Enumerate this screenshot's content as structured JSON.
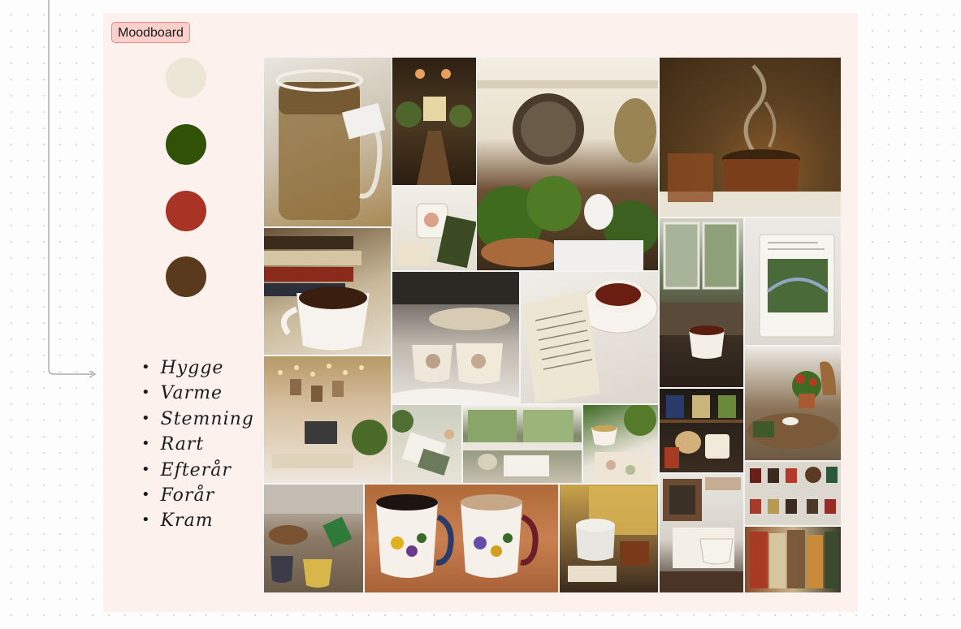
{
  "frame": {
    "label": "Moodboard"
  },
  "palette": [
    {
      "name": "cream",
      "color": "#ebe6d5"
    },
    {
      "name": "forest-green",
      "color": "#2f5207"
    },
    {
      "name": "rust-red",
      "color": "#a93324"
    },
    {
      "name": "chocolate-brown",
      "color": "#5a3a1c"
    }
  ],
  "keywords": [
    "Hygge",
    "Varme",
    "Stemning",
    "Rart",
    "Efterår",
    "Forår",
    "Kram"
  ],
  "photos": [
    "tea-glass-photo",
    "cozy-shop-photo",
    "herbs-kitchen-photo",
    "steaming-pot-photo",
    "floral-mug-photo",
    "books-tea-photo",
    "teacups-linen-photo",
    "tea-book-photo",
    "window-tea-photo",
    "monet-book-photo",
    "fairy-lights-desk-photo",
    "desk-notebook-photo",
    "window-desk-photo",
    "leaves-table-photo",
    "tea-shelf-photo",
    "herb-tray-photo",
    "pouring-tea-photo",
    "floral-mugs-photo",
    "autumn-window-photo",
    "framed-tea-photo",
    "tea-cards-photo",
    "wardrobe-photo"
  ]
}
